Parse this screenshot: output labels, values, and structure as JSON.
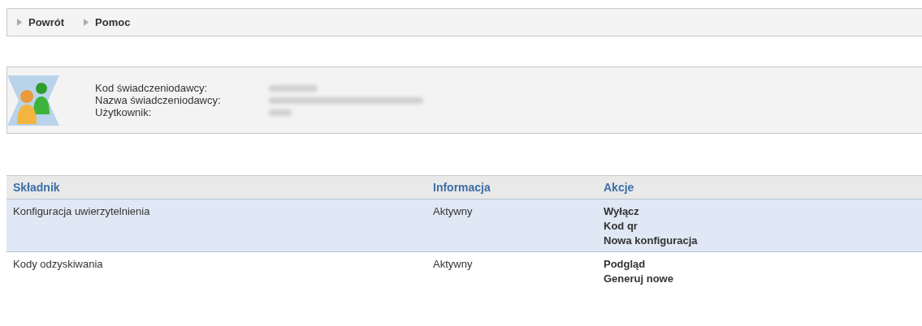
{
  "nav": [
    {
      "label": "Powrót"
    },
    {
      "label": "Pomoc"
    }
  ],
  "provider": {
    "fields": [
      {
        "label": "Kod świadczeniodawcy:",
        "redacted": true
      },
      {
        "label": "Nazwa świadczeniodawcy:",
        "redacted": true
      },
      {
        "label": "Użytkownik:",
        "redacted": true
      }
    ]
  },
  "table": {
    "columns": [
      "Składnik",
      "Informacja",
      "Akcje"
    ],
    "rows": [
      {
        "component": "Konfiguracja uwierzytelnienia",
        "info": "Aktywny",
        "selected": true,
        "actions": [
          "Wyłącz",
          "Kod qr",
          "Nowa konfiguracja"
        ]
      },
      {
        "component": "Kody odzyskiwania",
        "info": "Aktywny",
        "selected": false,
        "actions": [
          "Podgląd",
          "Generuj nowe"
        ]
      }
    ]
  }
}
